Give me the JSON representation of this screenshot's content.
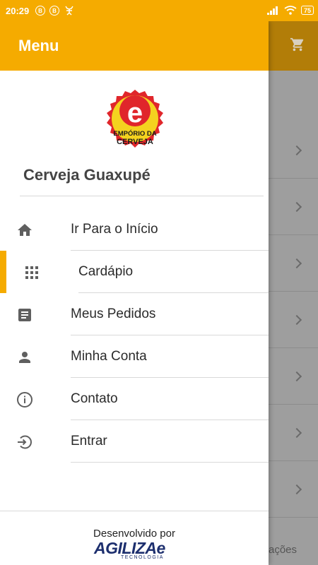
{
  "status_bar": {
    "time": "20:29",
    "left_icons": [
      "B",
      "B"
    ],
    "battery": "75"
  },
  "background": {
    "bottom_text": "ações"
  },
  "drawer": {
    "title": "Menu",
    "store_name": "Cerveja Guaxupé",
    "logo": {
      "letter": "e",
      "line1": "EMPÓRIO DA",
      "line2": "CERVEJA"
    },
    "items": [
      {
        "label": "Ir Para o Início",
        "icon": "home-icon",
        "active": false
      },
      {
        "label": "Cardápio",
        "icon": "grid-icon",
        "active": true
      },
      {
        "label": "Meus Pedidos",
        "icon": "document-icon",
        "active": false
      },
      {
        "label": "Minha Conta",
        "icon": "person-icon",
        "active": false
      },
      {
        "label": "Contato",
        "icon": "info-icon",
        "active": false
      },
      {
        "label": "Entrar",
        "icon": "login-icon",
        "active": false
      }
    ],
    "footer": {
      "developed_by": "Desenvolvido por",
      "company": "AGILIZAe",
      "company_sub": "TECNOLOGIA"
    }
  },
  "colors": {
    "accent": "#f5ab00",
    "icon": "#5f5f5f"
  }
}
